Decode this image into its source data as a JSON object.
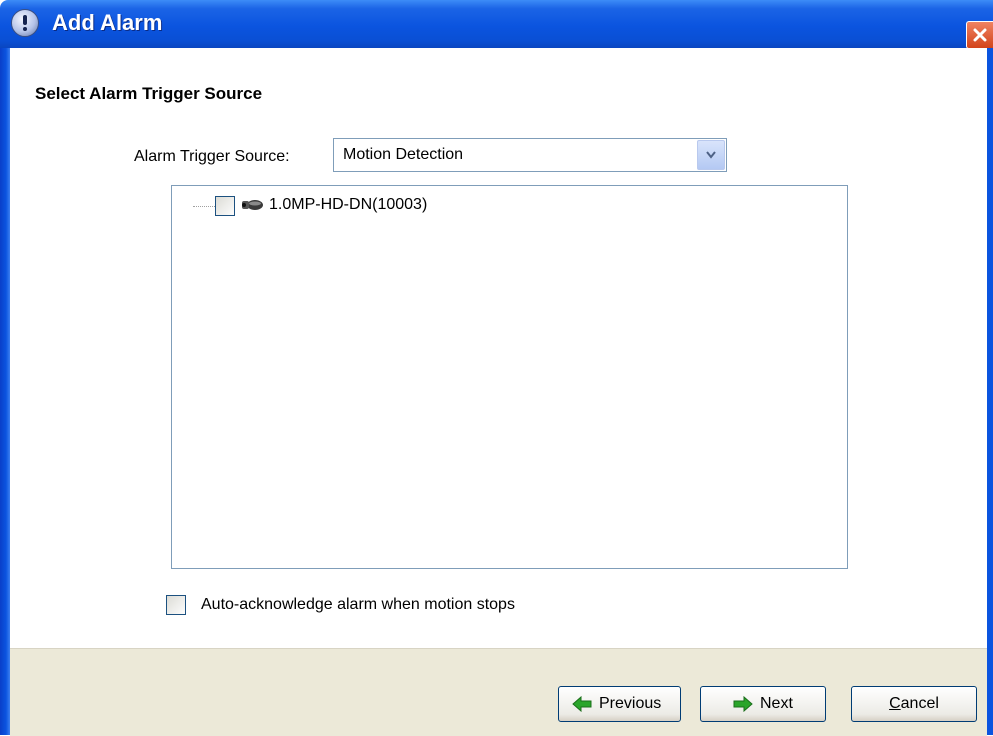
{
  "window": {
    "title": "Add Alarm"
  },
  "page": {
    "heading": "Select Alarm Trigger Source",
    "source": {
      "label": "Alarm Trigger Source:",
      "selected": "Motion Detection"
    },
    "tree": {
      "items": [
        {
          "label": "1.0MP-HD-DN(10003)",
          "checked": false
        }
      ]
    },
    "auto_ack": {
      "label": "Auto-acknowledge alarm when motion stops",
      "checked": false
    }
  },
  "buttons": {
    "previous": "Previous",
    "next": "Next",
    "cancel": "Cancel"
  },
  "colors": {
    "titlebar": "#0b54df",
    "footer": "#ece9d8",
    "close": "#d2431a",
    "arrow": "#2aa52a"
  }
}
